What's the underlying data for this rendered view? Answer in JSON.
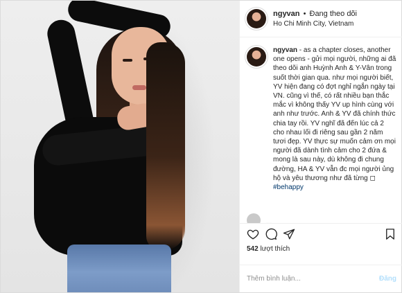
{
  "header": {
    "username": "ngyvan",
    "separator": "•",
    "follow_status": "Đang theo dõi",
    "location": "Ho Chi Minh City, Vietnam"
  },
  "caption": {
    "username": "ngyvan",
    "body": " - as a chapter closes, another one opens - gửi mọi người, những ai đã theo dõi anh Huỳnh Anh & Y-Vân trong suốt thời gian qua. như mọi người biết, YV hiện đang có đợt nghỉ ngắn ngày tại VN. cũng vì thế, có rất nhiều bạn thắc mắc vì không thấy YV up hình cùng với anh như trước. Anh & YV đã chính thức chia tay rồi. YV nghĩ đã đến lúc cả 2 cho nhau lối đi riêng sau gần 2 năm tươi đẹp. YV thực sự muốn cảm ơn mọi người đã dành tình cảm cho 2 đứa & mong là sau này, dù không đi chung đường, HA & YV vẫn đc mọi người ủng hộ và yêu thương như đã từng ◻ ",
    "hashtag": "#behappy"
  },
  "next_comment_preview": "...",
  "actions": {
    "like_icon": "heart-icon",
    "comment_icon": "comment-icon",
    "share_icon": "paper-plane-icon",
    "save_icon": "bookmark-icon"
  },
  "likes": {
    "count": "542",
    "label": "lượt thích"
  },
  "comment_box": {
    "placeholder": "Thêm bình luận...",
    "post_label": "Đăng"
  },
  "colors": {
    "link": "#00376b",
    "post_button_disabled": "#b2dffc",
    "muted": "#8e8e8e"
  }
}
